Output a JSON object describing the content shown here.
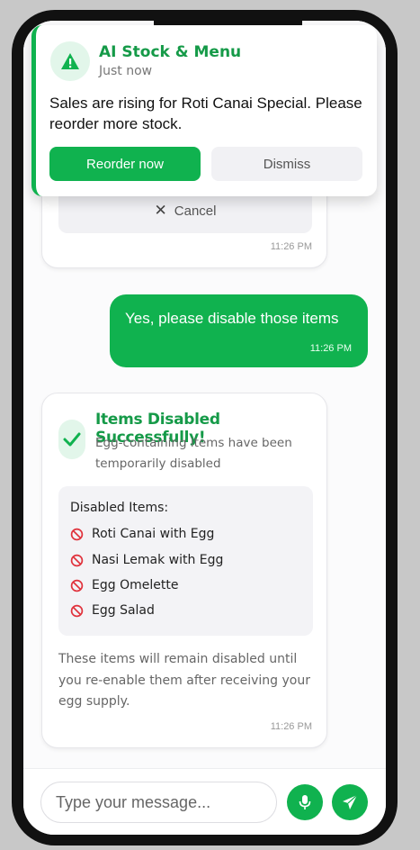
{
  "notification": {
    "title": "AI Stock & Menu",
    "time": "Just now",
    "body": "Sales are rising for Roti Canai Special. Please reorder more stock.",
    "reorder_label": "Reorder now",
    "dismiss_label": "Dismiss",
    "icon": "warning-icon"
  },
  "messages": {
    "ai_prev": {
      "cancel_label": "Cancel",
      "time": "11:26 PM"
    },
    "user": {
      "text": "Yes, please disable those items",
      "time": "11:26 PM"
    },
    "ai_success": {
      "title": "Items Disabled Successfully!",
      "subtitle": "Egg-containing items have been temporarily disabled",
      "list_heading": "Disabled Items:",
      "items": [
        "Roti Canai with Egg",
        "Nasi Lemak with Egg",
        "Egg Omelette",
        "Egg Salad"
      ],
      "note": "These items will remain disabled until you re-enable them after receiving your egg supply.",
      "time": "11:26 PM"
    }
  },
  "input": {
    "placeholder": "Type your message..."
  },
  "colors": {
    "accent": "#10b24f",
    "accent_dark": "#159a48",
    "danger": "#e0323c"
  }
}
